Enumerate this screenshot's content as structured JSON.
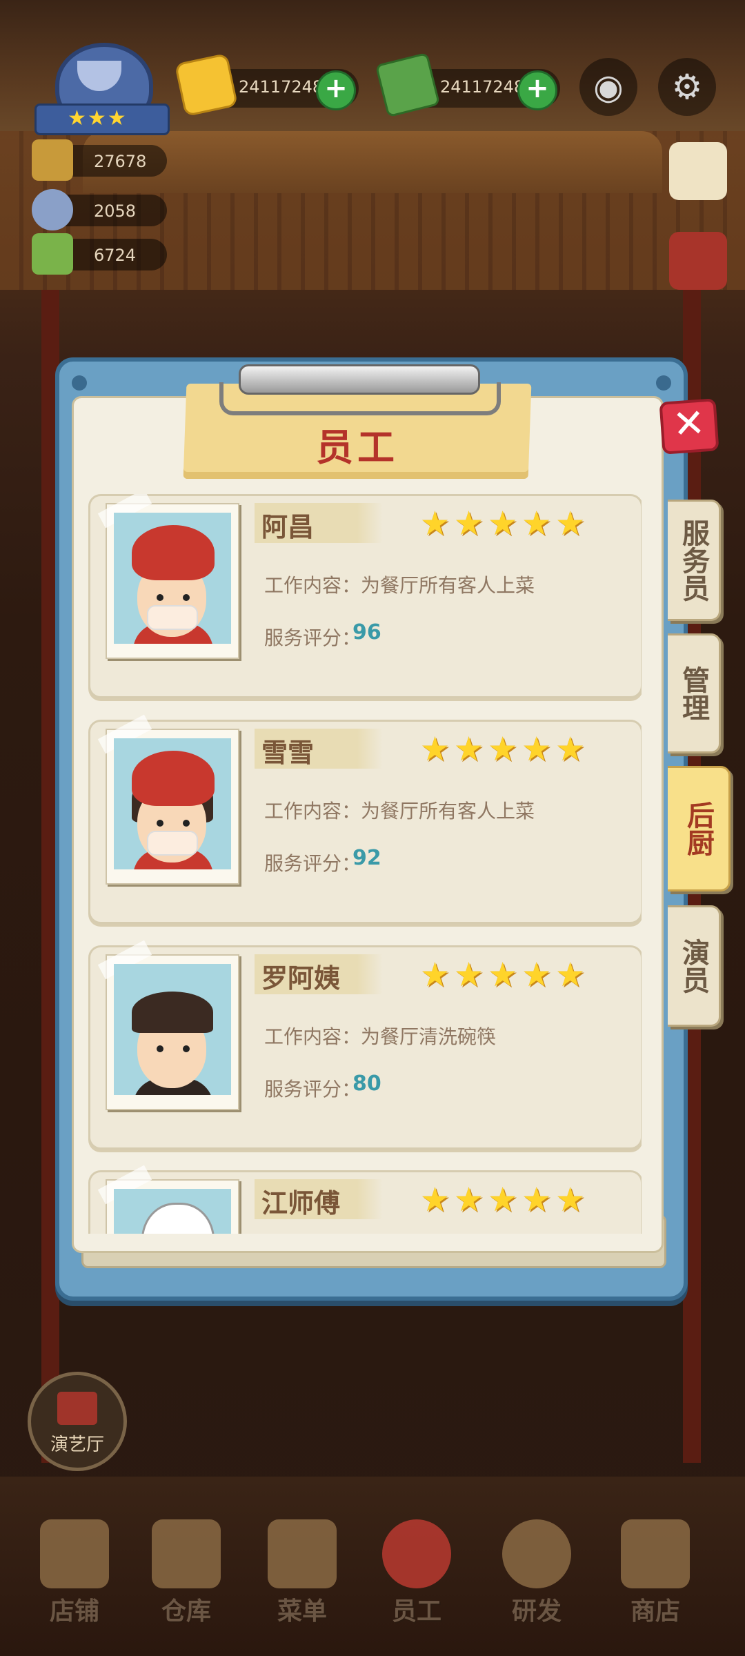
{
  "hud": {
    "currency_gold": "24117248",
    "currency_cash": "24117248",
    "stats": [
      "27678",
      "2058",
      "6724"
    ],
    "badge_stars": "★★★"
  },
  "modal": {
    "title": "员工",
    "close_label": "✕",
    "tabs": [
      {
        "label": "服务员",
        "active": false
      },
      {
        "label": "管理",
        "active": false
      },
      {
        "label": "后厨",
        "active": true
      },
      {
        "label": "演员",
        "active": false
      }
    ],
    "staff": [
      {
        "name": "阿昌",
        "stars": "★★★★★",
        "job": "工作内容：为餐厅所有客人上菜",
        "score_label": "服务评分：",
        "score": "96"
      },
      {
        "name": "雪雪",
        "stars": "★★★★★",
        "job": "工作内容：为餐厅所有客人上菜",
        "score_label": "服务评分：",
        "score": "92"
      },
      {
        "name": "罗阿姨",
        "stars": "★★★★★",
        "job": "工作内容：为餐厅清洗碗筷",
        "score_label": "服务评分：",
        "score": "80"
      },
      {
        "name": "江师傅",
        "stars": "★★★★★"
      }
    ]
  },
  "theater_button": "演艺厅",
  "bottom_nav": [
    "店铺",
    "仓库",
    "菜单",
    "员工",
    "研发",
    "商店"
  ]
}
